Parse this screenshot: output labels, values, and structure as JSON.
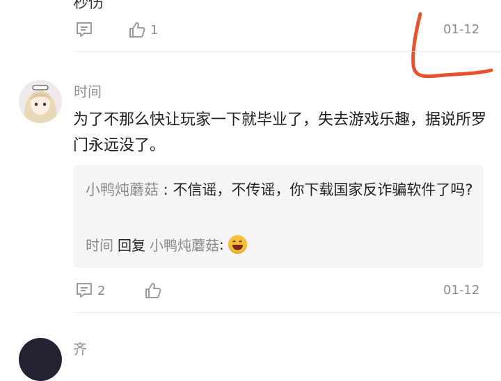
{
  "prev_comment": {
    "cut_text": "秒伤",
    "like_count": "1",
    "date": "01-12",
    "icons": [
      "comment-icon",
      "thumbs-up-icon"
    ]
  },
  "comment": {
    "username": "时间",
    "text": "为了不那么快让玩家一下就毕业了，失去游戏乐趣，据说所罗门永远没了。",
    "reply": {
      "author": "小鸭炖蘑菇",
      "sep1": " : ",
      "text": "不信谣，不传谣，你下载国家反诈骗软件了吗?",
      "responder": "时间",
      "action": "回复",
      "target": "小鸭炖蘑菇",
      "sep2": " : ",
      "emoji": "grinning-face"
    },
    "comment_count": "2",
    "date": "01-12"
  },
  "next_comment": {
    "cut_name": "齐"
  },
  "colors": {
    "text": "#1d1d1d",
    "muted": "#8a8a8a",
    "reply_bg": "#f5f5f5",
    "annotation": "#e8502e"
  }
}
